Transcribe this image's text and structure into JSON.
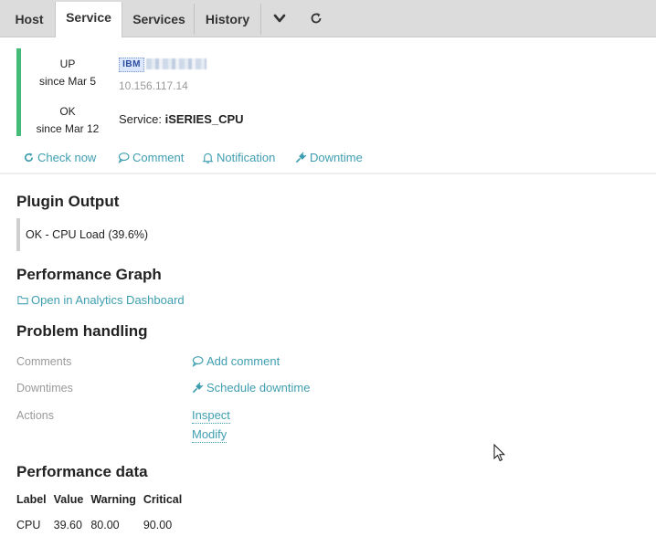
{
  "tabs": [
    {
      "label": "Host",
      "active": false
    },
    {
      "label": "Service",
      "active": true
    },
    {
      "label": "Services",
      "active": false
    },
    {
      "label": "History",
      "active": false
    }
  ],
  "tab_icons": [
    "chevron-down-icon",
    "refresh-icon"
  ],
  "host": {
    "state": "UP",
    "since": "since Mar 5",
    "logo_text": "IBM",
    "ip": "10.156.117.14"
  },
  "service": {
    "state": "OK",
    "since": "since Mar 12",
    "prefix": "Service: ",
    "name": "iSERIES_CPU"
  },
  "actions": {
    "check_now": "Check now",
    "comment": "Comment",
    "notification": "Notification",
    "downtime": "Downtime"
  },
  "plugin_output": {
    "heading": "Plugin Output",
    "text": "OK - CPU Load (39.6%)"
  },
  "performance_graph": {
    "heading": "Performance Graph",
    "link": "Open in Analytics Dashboard"
  },
  "problem_handling": {
    "heading": "Problem handling",
    "comments_label": "Comments",
    "add_comment": "Add comment",
    "downtimes_label": "Downtimes",
    "schedule_downtime": "Schedule downtime",
    "actions_label": "Actions",
    "inspect": "Inspect",
    "modify": "Modify"
  },
  "performance_data": {
    "heading": "Performance data",
    "columns": [
      "Label",
      "Value",
      "Warning",
      "Critical"
    ],
    "rows": [
      [
        "CPU",
        "39.60",
        "80.00",
        "90.00"
      ]
    ]
  },
  "colors": {
    "ok_green": "#44bb77",
    "link": "#3e9eb0",
    "tabbar_bg": "#dcdcdc"
  }
}
